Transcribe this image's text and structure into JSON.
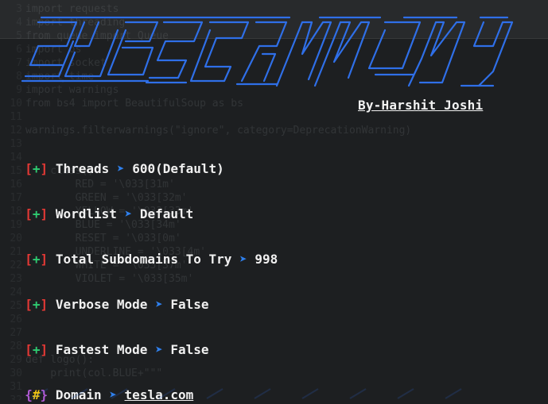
{
  "author": "By-Harshit Joshi",
  "banner": {
    "color": "#2f6fe8"
  },
  "options": [
    {
      "symbol": "+",
      "label": "Threads",
      "value": "600(Default)"
    },
    {
      "symbol": "+",
      "label": "Wordlist",
      "value": "Default"
    },
    {
      "symbol": "+",
      "label": "Total Subdomains To Try",
      "value": "998"
    },
    {
      "symbol": "+",
      "label": "Verbose Mode",
      "value": "False"
    },
    {
      "symbol": "+",
      "label": "Fastest Mode",
      "value": "False"
    }
  ],
  "domain": {
    "symbol": "#",
    "label": "Domain",
    "value": "tesla.com"
  },
  "arrow_glyph": "➤",
  "background_code": [
    {
      "n": "3",
      "text": "import requests"
    },
    {
      "n": "4",
      "text": "import threading"
    },
    {
      "n": "5",
      "text": "from queue import Queue"
    },
    {
      "n": "6",
      "text": "import os"
    },
    {
      "n": "7",
      "text": "import socket"
    },
    {
      "n": "8",
      "text": "import time"
    },
    {
      "n": "9",
      "text": "import warnings"
    },
    {
      "n": "10",
      "text": "from bs4 import BeautifulSoup as bs"
    },
    {
      "n": "11",
      "text": ""
    },
    {
      "n": "12",
      "text": "warnings.filterwarnings(\"ignore\", category=DeprecationWarning)"
    },
    {
      "n": "13",
      "text": ""
    },
    {
      "n": "14",
      "text": ""
    },
    {
      "n": "15",
      "text": "    class():"
    },
    {
      "n": "16",
      "text": "        RED = '\\033[31m'"
    },
    {
      "n": "17",
      "text": "        GREEN = '\\033[32m'"
    },
    {
      "n": "18",
      "text": "        YELLOW = '\\033[33m'"
    },
    {
      "n": "19",
      "text": "        BLUE = '\\033[34m'"
    },
    {
      "n": "20",
      "text": "        RESET = '\\033[0m'"
    },
    {
      "n": "21",
      "text": "        UNDERLINE = '\\033[4m'"
    },
    {
      "n": "22",
      "text": "        WHITE = '\\033[37m'"
    },
    {
      "n": "23",
      "text": "        VIOLET = '\\033[35m'"
    },
    {
      "n": "24",
      "text": ""
    },
    {
      "n": "25",
      "text": ""
    },
    {
      "n": "26",
      "text": ""
    },
    {
      "n": "27",
      "text": ""
    },
    {
      "n": "28",
      "text": ""
    },
    {
      "n": "29",
      "text": "def logo():"
    },
    {
      "n": "30",
      "text": "    print(col.BLUE+\"\"\""
    },
    {
      "n": "31",
      "text": ""
    },
    {
      "n": "32",
      "text": ""
    }
  ]
}
